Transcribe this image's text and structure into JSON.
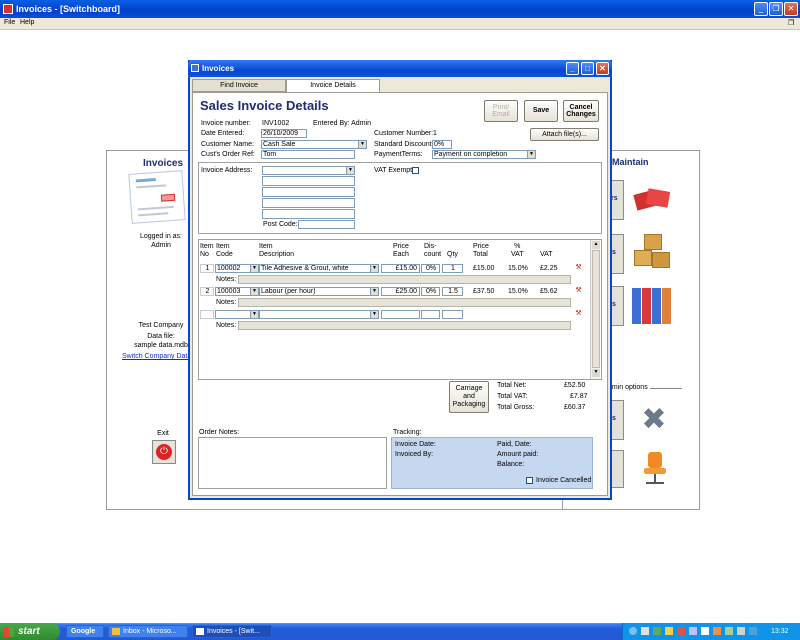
{
  "app": {
    "title": "Invoices - [Switchboard]",
    "menu": [
      "File",
      "Help"
    ]
  },
  "switchboard": {
    "invoices_heading": "Invoices",
    "maintain_heading": "Maintain",
    "logged_in_label": "Logged in as:",
    "logged_in_user": "Admin",
    "company": "Test Company",
    "data_file_label": "Data file:",
    "data_file": "sample data.mdb",
    "switch_link": "Switch Company Data",
    "admin_options": "dmin options",
    "exit_label": "Exit",
    "btn_fragments": [
      "rs",
      "s",
      "s",
      "s"
    ]
  },
  "dialog": {
    "title": "Invoices",
    "tabs": [
      "Find Invoice",
      "Invoice Details"
    ],
    "heading": "Sales Invoice Details",
    "buttons": {
      "print": "Print/ Email",
      "save": "Save",
      "cancel": "Cancel Changes",
      "attach": "Attach file(s)..."
    },
    "invoice_number_label": "Invoice number:",
    "invoice_number": "INV1002",
    "entered_by": "Entered By: Admin",
    "date_entered_label": "Date Entered:",
    "date_entered": "26/10/2009",
    "customer_name_label": "Customer Name:",
    "customer_name": "Cash Sale",
    "order_ref_label": "Cust's Order Ref:",
    "order_ref": "Tom",
    "customer_number_label": "Customer Number:",
    "customer_number": "1",
    "standard_discount_label": "Standard Discount:",
    "standard_discount": "0%",
    "payment_terms_label": "PaymentTerms:",
    "payment_terms": "Payment on completion",
    "invoice_address_label": "Invoice Address:",
    "post_code_label": "Post Code:",
    "vat_exempt_label": "VAT Exempt",
    "columns": [
      "Item\nNo",
      "Item\nCode",
      "Item\nDescription",
      "Price\nEach",
      "Dis-\ncount",
      "Qty",
      "Price\nTotal",
      "%\nVAT",
      "VAT"
    ],
    "rows": [
      {
        "no": "1",
        "code": "100002",
        "desc": "Tile Adhesive & Grout, white",
        "price": "£15.00",
        "disc": "0%",
        "qty": "1",
        "total": "£15.00",
        "vatpct": "15.0%",
        "vat": "£2.25"
      },
      {
        "no": "2",
        "code": "100003",
        "desc": "Labour (per hour)",
        "price": "£25.00",
        "disc": "0%",
        "qty": "1.5",
        "total": "£37.50",
        "vatpct": "15.0%",
        "vat": "£5.62"
      }
    ],
    "notes_label": "Notes:",
    "carriage_button": "Carriage and Packaging",
    "total_net_label": "Total Net:",
    "total_net": "£52.50",
    "total_vat_label": "Total VAT:",
    "total_vat": "£7.87",
    "total_gross_label": "Total Gross:",
    "total_gross": "£60.37",
    "order_notes_label": "Order Notes:",
    "tracking_label": "Tracking:",
    "invoice_date_label": "Invoice Date:",
    "invoiced_by_label": "Invoiced By:",
    "paid_date_label": "Paid, Date:",
    "amount_paid_label": "Amount paid:",
    "balance_label": "Balance:",
    "invoice_cancelled_label": "Invoice Cancelled"
  },
  "taskbar": {
    "start": "start",
    "google": "Google",
    "tasks": [
      "Inbox - Microso...",
      "Invoices - [Swit..."
    ],
    "clock": "13:32"
  },
  "colors": {
    "accent": "#0746d0",
    "heading": "#1f2c70"
  }
}
